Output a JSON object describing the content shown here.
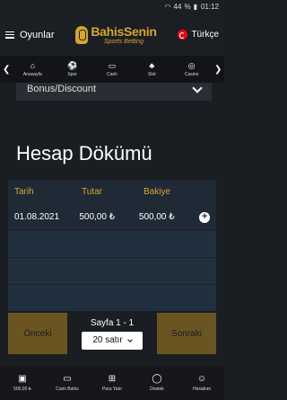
{
  "status": {
    "signal_label": "44",
    "battery_label": "%",
    "time": "01:12"
  },
  "header": {
    "menu_label": "Oyunlar",
    "logo_main": "BahisSenin",
    "logo_sub": "Sports Betting",
    "lang_label": "Türkçe"
  },
  "categories": [
    {
      "label": "Anasayfa",
      "icon": "home-icon"
    },
    {
      "label": "Spor",
      "icon": "shoe-icon"
    },
    {
      "label": "Canlı",
      "icon": "tv-icon"
    },
    {
      "label": "Slot",
      "icon": "cherry-icon"
    },
    {
      "label": "Casino",
      "icon": "chip-icon"
    }
  ],
  "bonus": {
    "label": "Bonus/Discount"
  },
  "page_title": "Hesap Dökümü",
  "table": {
    "headers": [
      "Tarih",
      "Tutar",
      "Bakiye"
    ],
    "rows": [
      {
        "date": "01.08.2021",
        "amount": "500,00 ₺",
        "balance": "500,00 ₺"
      }
    ]
  },
  "pager": {
    "prev_label": "Önceki",
    "next_label": "Sonraki",
    "page_label": "Sayfa 1 - 1",
    "rows_select": "20 satır"
  },
  "bottom": [
    {
      "label": "500,00 ₺",
      "icon": "wallet-icon"
    },
    {
      "label": "Canlı Bahis",
      "icon": "tv-icon"
    },
    {
      "label": "Para Yatır",
      "icon": "cart-icon"
    },
    {
      "label": "Destek",
      "icon": "chat-icon"
    },
    {
      "label": "Hesabım",
      "icon": "user-icon"
    }
  ]
}
